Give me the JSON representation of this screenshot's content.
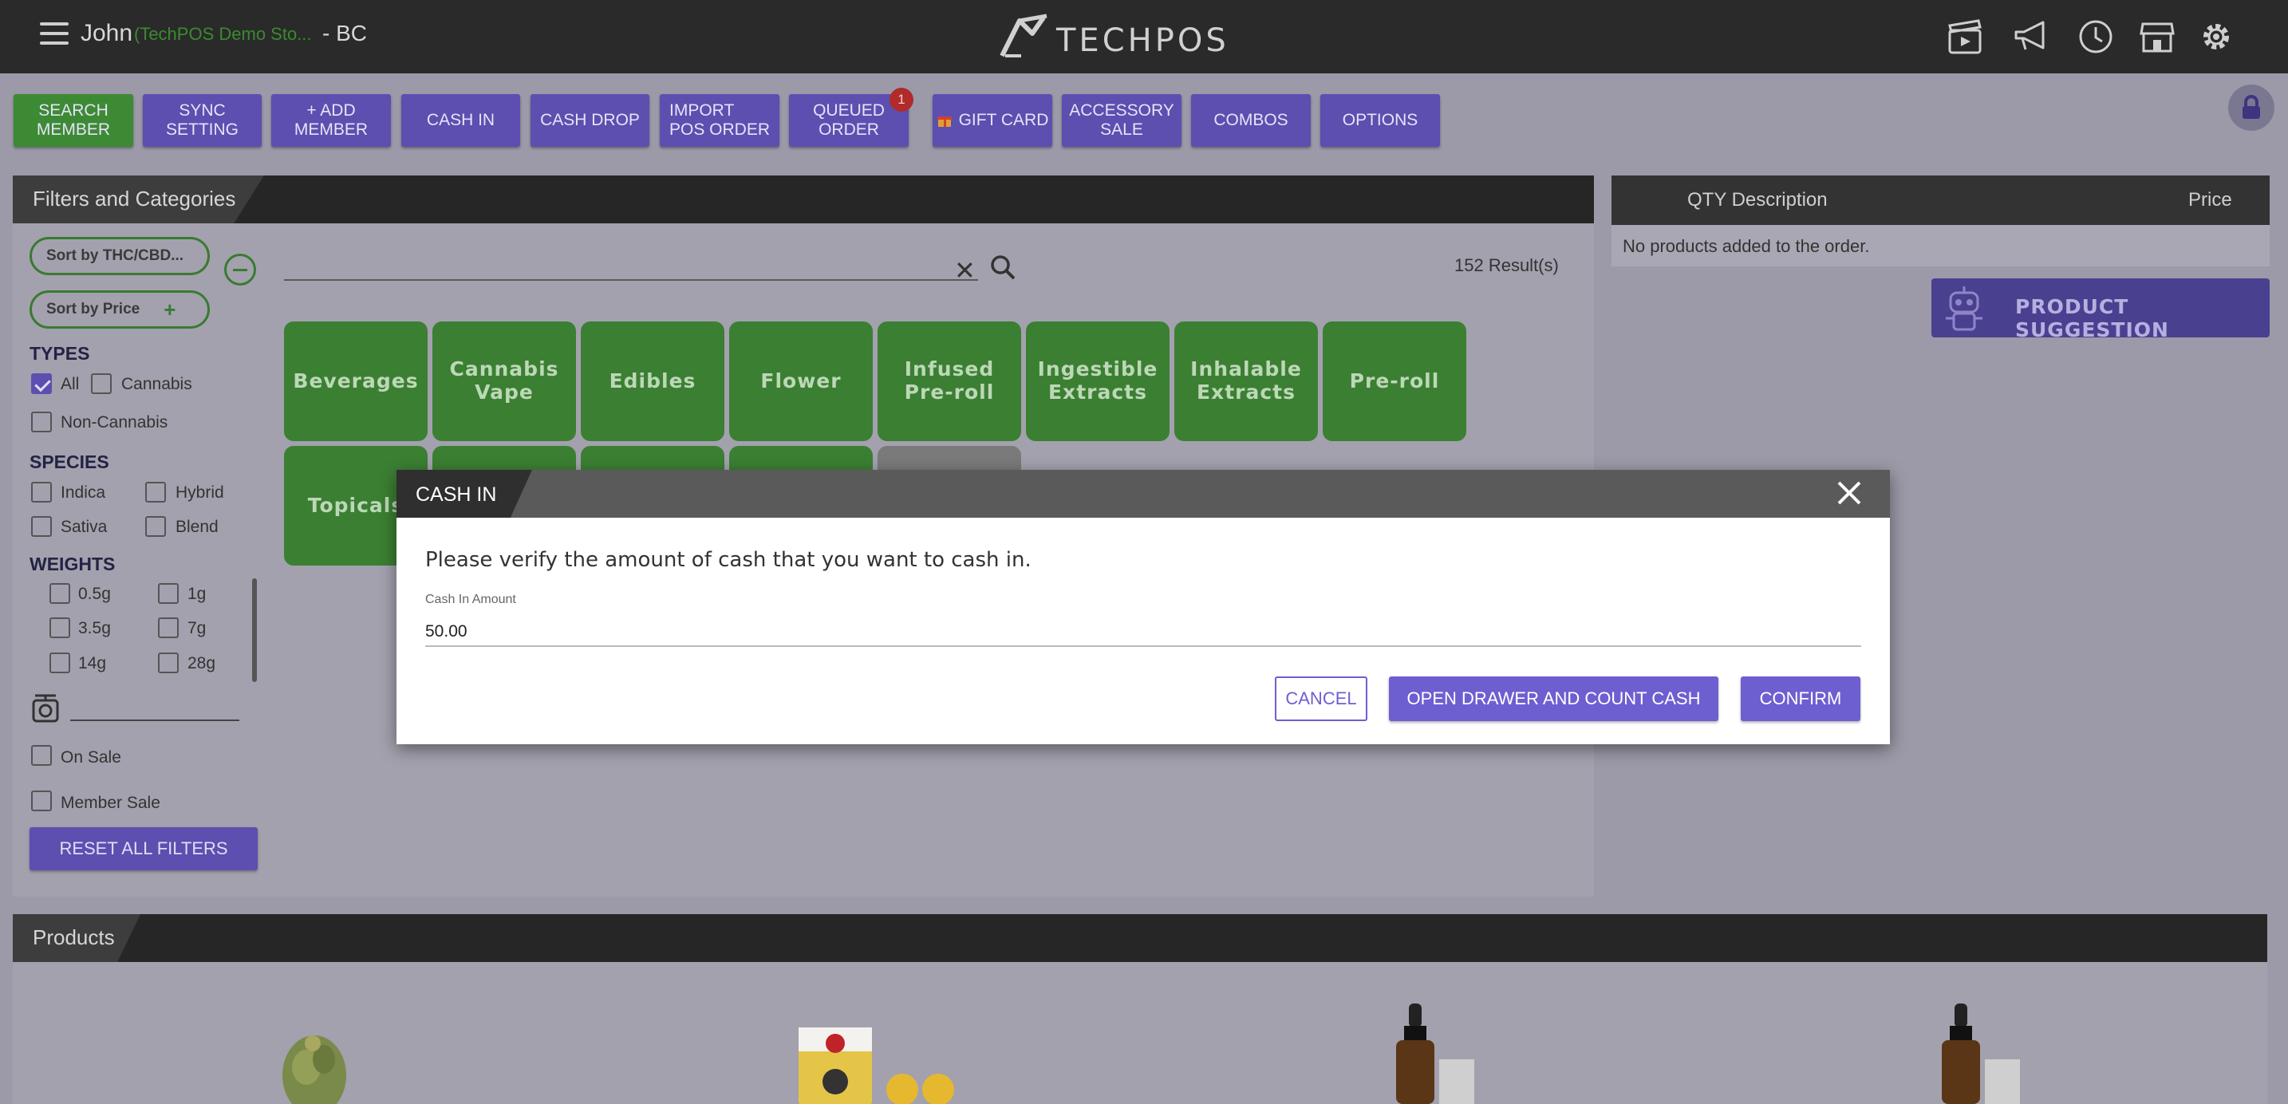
{
  "header": {
    "user": "John",
    "store": "(TechPOS Demo Sto...",
    "province": "- BC",
    "logo_text": "TECHPOS",
    "icons": [
      "video-icon",
      "megaphone-icon",
      "clock-icon",
      "store-icon",
      "gear-icon"
    ]
  },
  "actions": {
    "search_member": "SEARCH\nMEMBER",
    "sync_setting": "SYNC\nSETTING",
    "add_member": "+ ADD\nMEMBER",
    "cash_in": "CASH IN",
    "cash_drop": "CASH DROP",
    "import_pos_order": "IMPORT\nPOS ORDER",
    "queued_order": "QUEUED\nORDER",
    "queued_badge": "1",
    "gift_card": "GIFT CARD",
    "accessory_sale": "ACCESSORY\nSALE",
    "combos": "COMBOS",
    "options": "OPTIONS"
  },
  "filters": {
    "title": "Filters and Categories",
    "sort_thc": "Sort by THC/CBD...",
    "sort_price": "Sort by Price",
    "types_label": "TYPES",
    "types": [
      {
        "label": "All",
        "checked": true
      },
      {
        "label": "Cannabis",
        "checked": false
      },
      {
        "label": "Non-Cannabis",
        "checked": false
      }
    ],
    "species_label": "SPECIES",
    "species": [
      "Indica",
      "Hybrid",
      "Sativa",
      "Blend"
    ],
    "weights_label": "WEIGHTS",
    "weights": [
      "0.5g",
      "1g",
      "3.5g",
      "7g",
      "14g",
      "28g"
    ],
    "on_sale": "On Sale",
    "member_sale": "Member Sale",
    "reset": "RESET ALL FILTERS",
    "results": "152 Result(s)",
    "categories": [
      "Beverages",
      "Cannabis Vape",
      "Edibles",
      "Flower",
      "Infused Pre-roll",
      "Ingestible Extracts",
      "Inhalable Extracts",
      "Pre-roll",
      "Topicals"
    ]
  },
  "order": {
    "qty_description": "QTY Description",
    "price": "Price",
    "empty": "No products added to the order.",
    "suggestion": "PRODUCT SUGGESTION"
  },
  "products": {
    "title": "Products"
  },
  "modal": {
    "title": "CASH IN",
    "message": "Please verify the amount of cash that you want to cash in.",
    "field_label": "Cash In Amount",
    "field_value": "50.00",
    "cancel": "CANCEL",
    "open_drawer": "OPEN DRAWER AND COUNT CASH",
    "confirm": "CONFIRM"
  },
  "colors": {
    "accent": "#5c4fb0",
    "green": "#3b7f33",
    "topbar": "#2a2a2a"
  }
}
